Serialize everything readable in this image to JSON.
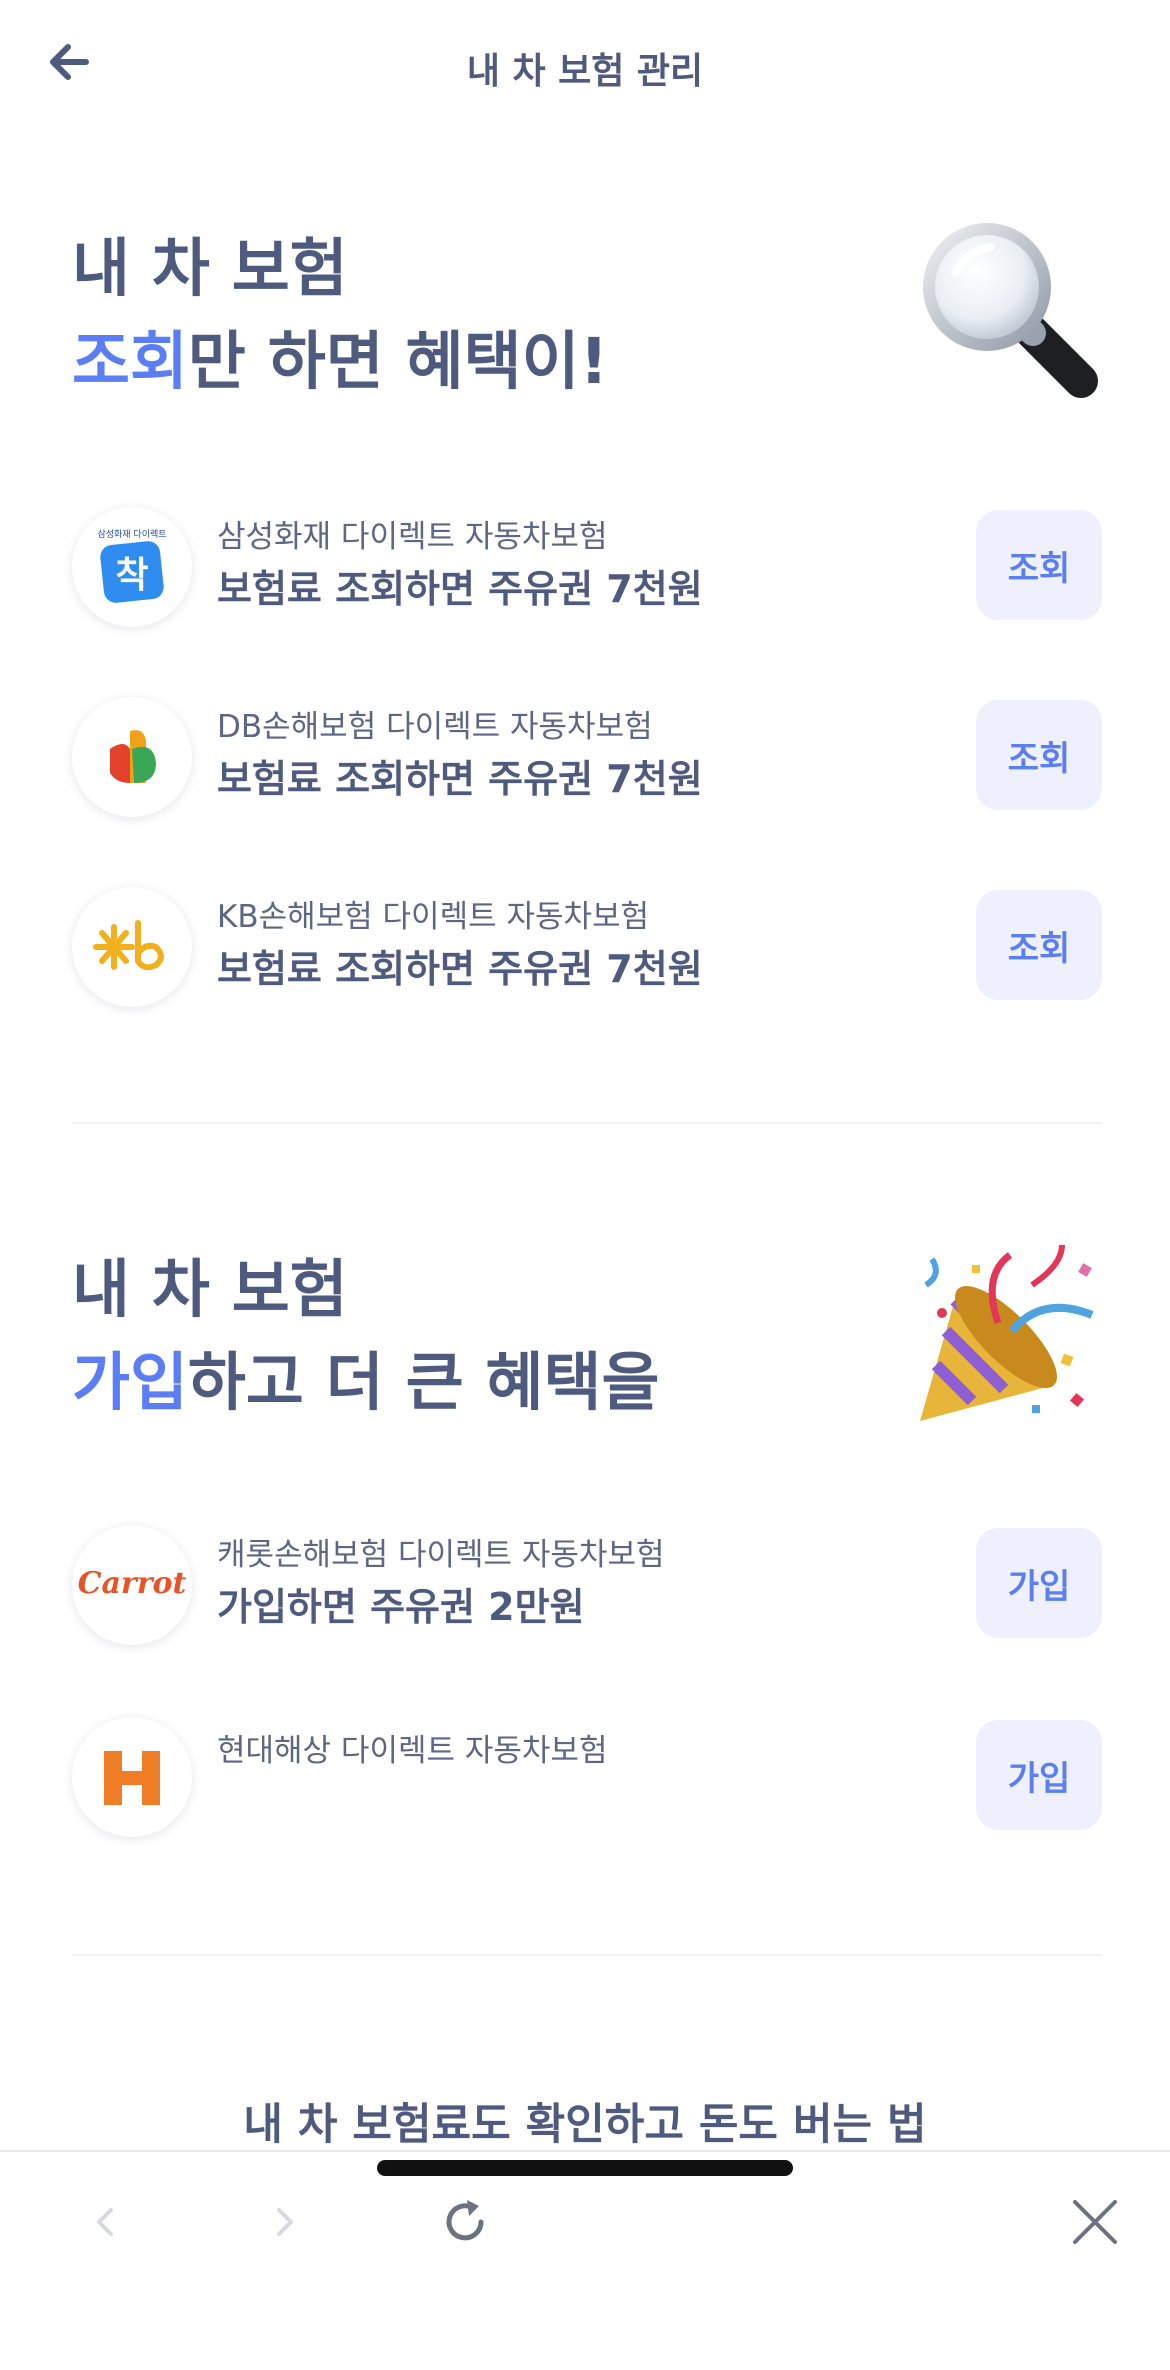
{
  "header": {
    "title": "내 차 보험 관리",
    "back_icon": "arrow-left-icon"
  },
  "section_inquiry": {
    "title_line1": "내 차 보험",
    "title_accent": "조회",
    "title_rest": "만 하면 혜택이!",
    "emoji": "magnifying-glass-icon",
    "items": [
      {
        "company": "삼성화재 다이렉트 자동차보험",
        "benefit": "보험료 조회하면 주유권 7천원",
        "button": "조회",
        "logo": "samsung-fire-logo",
        "logo_badge_text": "삼성화재 다이렉트",
        "logo_text": "착"
      },
      {
        "company": "DB손해보험 다이렉트 자동차보험",
        "benefit": "보험료 조회하면 주유권 7천원",
        "button": "조회",
        "logo": "db-insurance-logo"
      },
      {
        "company": "KB손해보험 다이렉트 자동차보험",
        "benefit": "보험료 조회하면 주유권 7천원",
        "button": "조회",
        "logo": "kb-insurance-logo"
      }
    ]
  },
  "section_signup": {
    "title_line1": "내 차 보험",
    "title_accent": "가입",
    "title_rest": "하고 더 큰 혜택을",
    "emoji": "party-popper-icon",
    "items": [
      {
        "company": "캐롯손해보험 다이렉트 자동차보험",
        "benefit": "가입하면 주유권 2만원",
        "button": "가입",
        "logo": "carrot-logo",
        "logo_text": "Carrot"
      },
      {
        "company": "현대해상 다이렉트 자동차보험",
        "button": "가입",
        "logo": "hyundai-marine-logo"
      }
    ]
  },
  "bottom_teaser": "내 차 보험료도 확인하고 돈도 버는 법",
  "toolbar": {
    "back_icon": "chevron-left-icon",
    "forward_icon": "chevron-right-icon",
    "reload_icon": "reload-icon",
    "close_icon": "close-icon"
  },
  "colors": {
    "accent": "#5b7ef5",
    "text": "#4e5a7e",
    "button_bg": "#eef1fd"
  }
}
